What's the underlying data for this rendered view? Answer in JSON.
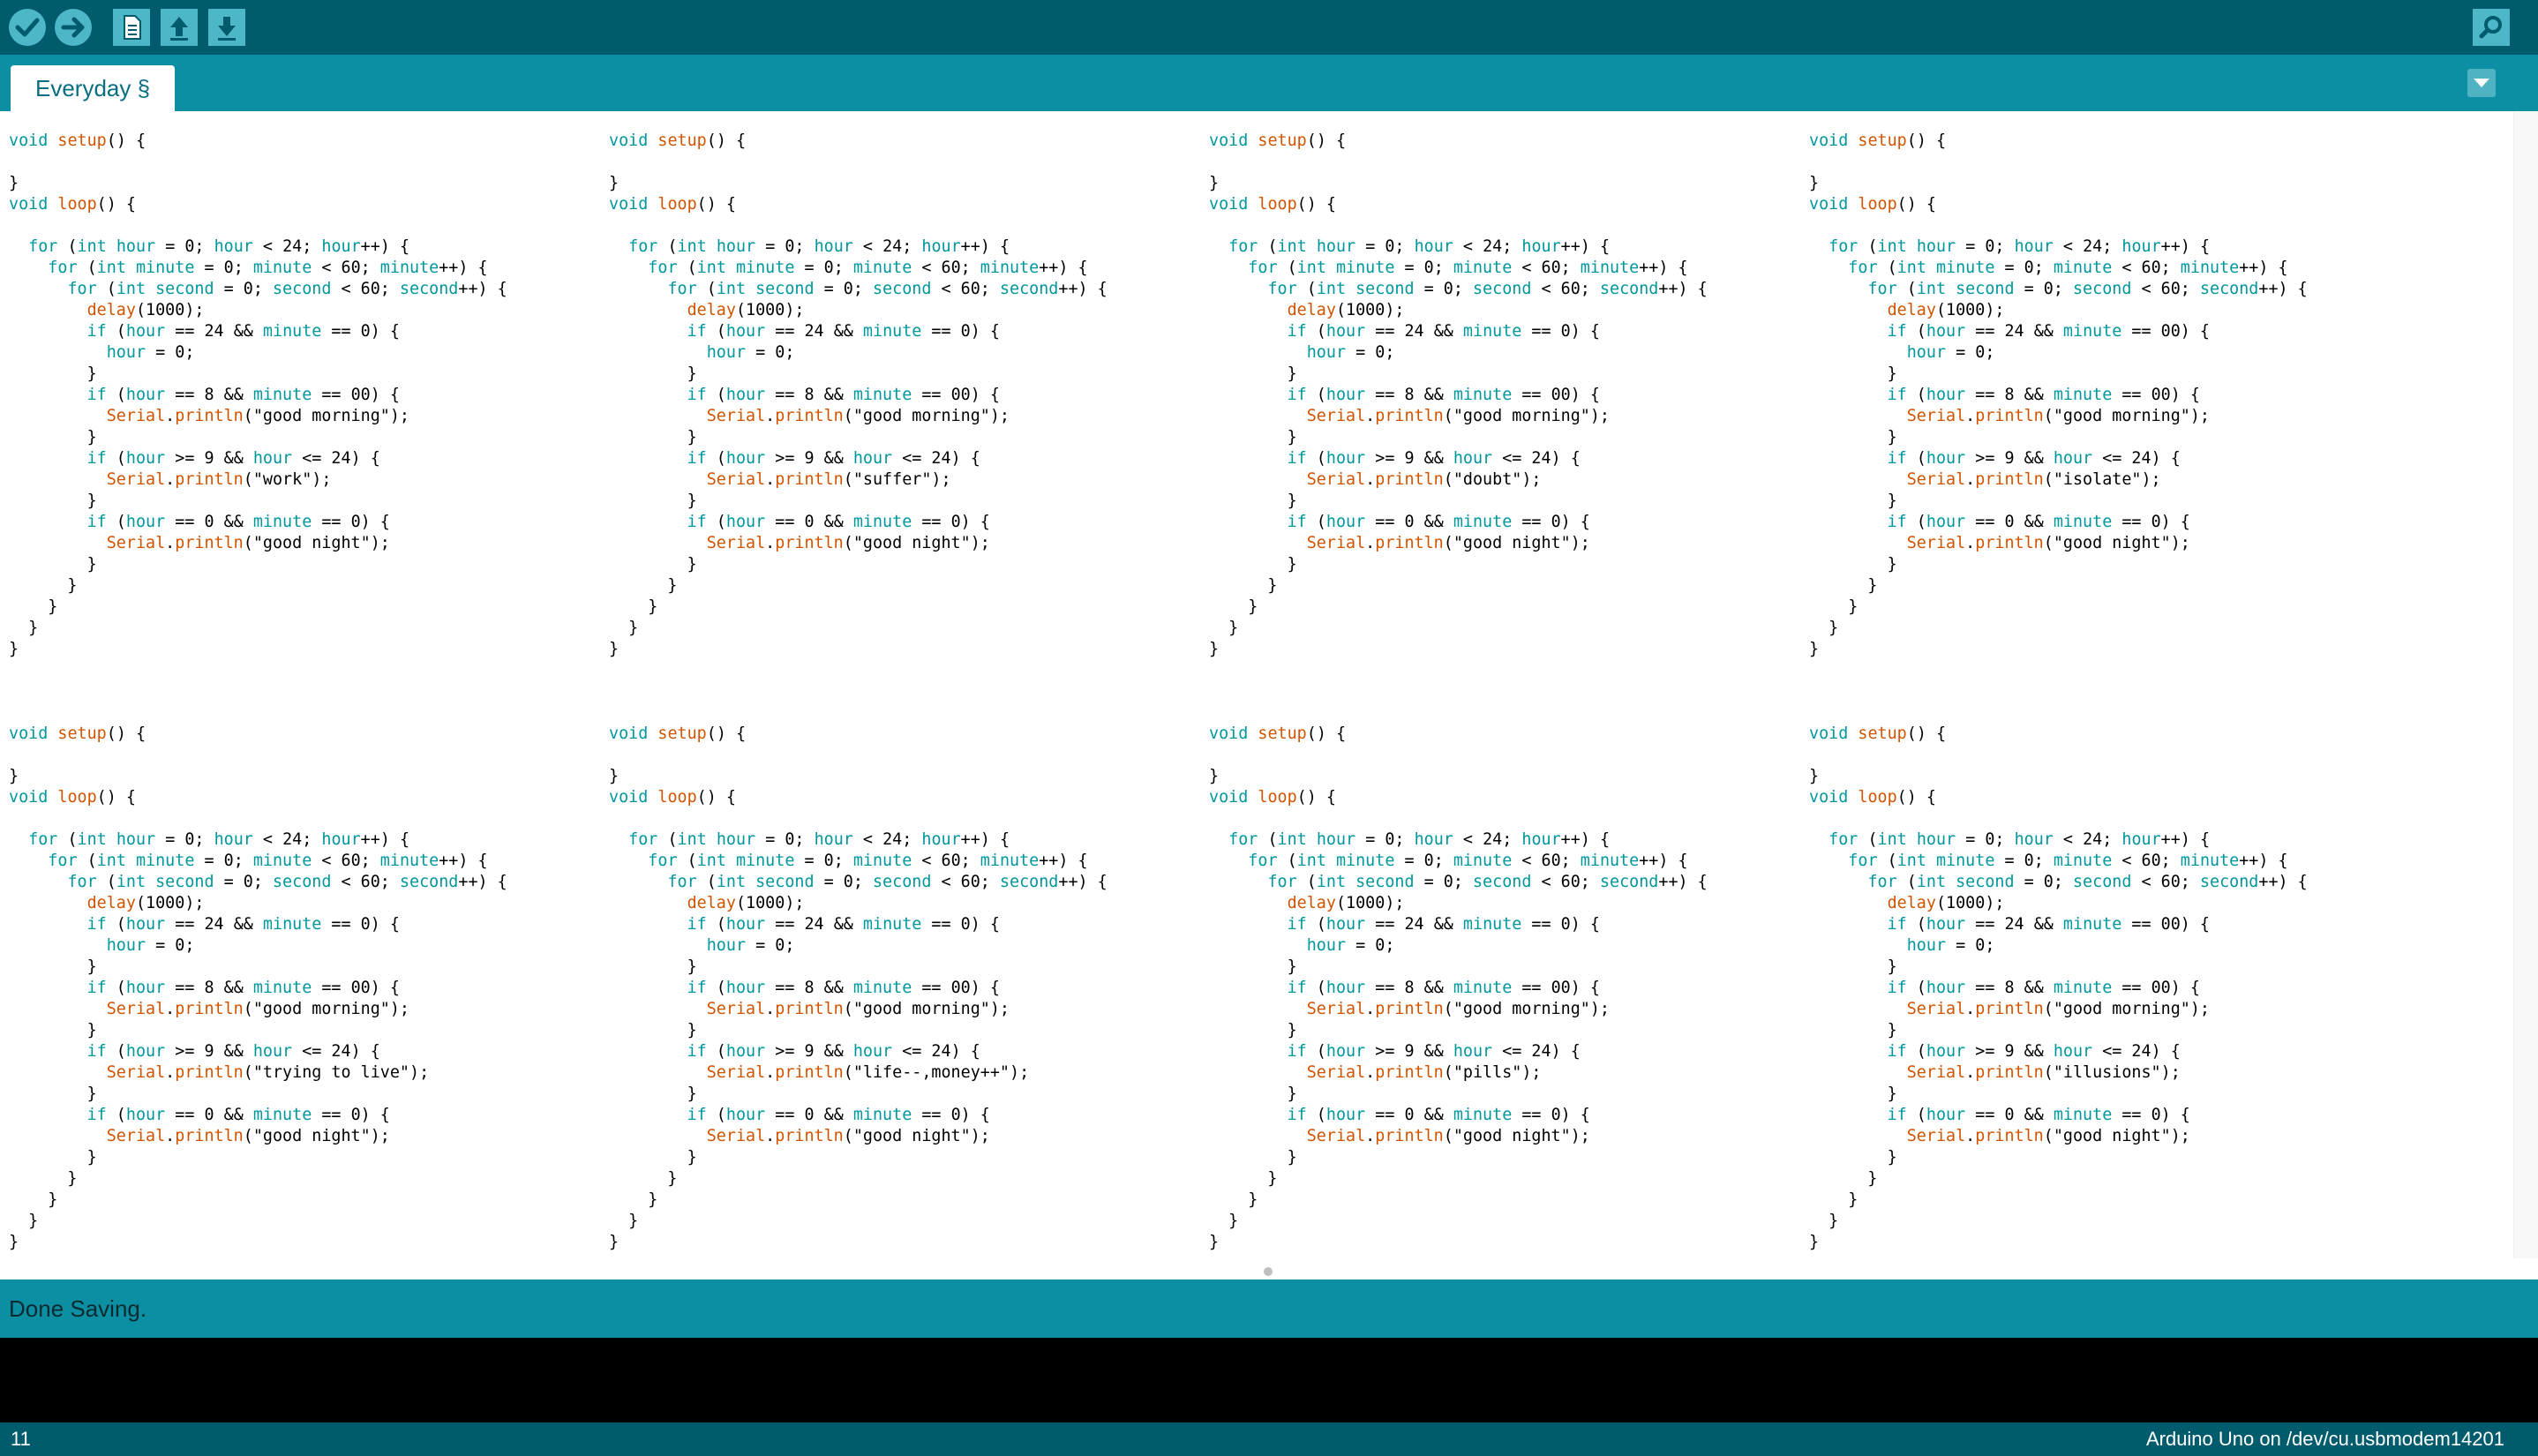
{
  "toolbar": {
    "buttons": [
      {
        "name": "verify",
        "icon": "checkmark-icon"
      },
      {
        "name": "upload",
        "icon": "arrow-right-icon"
      },
      {
        "name": "new",
        "icon": "document-icon"
      },
      {
        "name": "open",
        "icon": "arrow-up-icon"
      },
      {
        "name": "save",
        "icon": "arrow-down-icon"
      },
      {
        "name": "serial-monitor",
        "icon": "magnifier-icon"
      }
    ]
  },
  "tab": {
    "label": "Everyday §"
  },
  "blocks": [
    {
      "work": "work",
      "midnight_min": "0"
    },
    {
      "work": "suffer",
      "midnight_min": "0"
    },
    {
      "work": "doubt",
      "midnight_min": "0"
    },
    {
      "work": "isolate",
      "midnight_min": "00"
    },
    {
      "work": "trying to live",
      "midnight_min": "0"
    },
    {
      "work": "life--,money++",
      "midnight_min": "0"
    },
    {
      "work": "pills",
      "midnight_min": "0"
    },
    {
      "work": "illusions",
      "midnight_min": "00"
    }
  ],
  "code": {
    "setup_fn": "setup",
    "loop_fn": "loop",
    "delay_fn": "delay",
    "delay_ms": "1000",
    "serial_obj": "Serial",
    "println_fn": "println",
    "greeting_morning": "good morning",
    "greeting_night": "good night",
    "hours_limit": "24",
    "minutes_limit": "60",
    "seconds_limit": "60",
    "morning_hour": "8",
    "morning_minute": "00",
    "work_start_hour": "9"
  },
  "status": {
    "message": "Done Saving."
  },
  "footer": {
    "line": "11",
    "board": "Arduino Uno on /dev/cu.usbmodem14201"
  },
  "colors": {
    "toolbar_bg": "#005c6c",
    "tab_bar_bg": "#0c8fa3",
    "keyword": "#00979c",
    "function": "#d35400",
    "console_bg": "#000000"
  }
}
